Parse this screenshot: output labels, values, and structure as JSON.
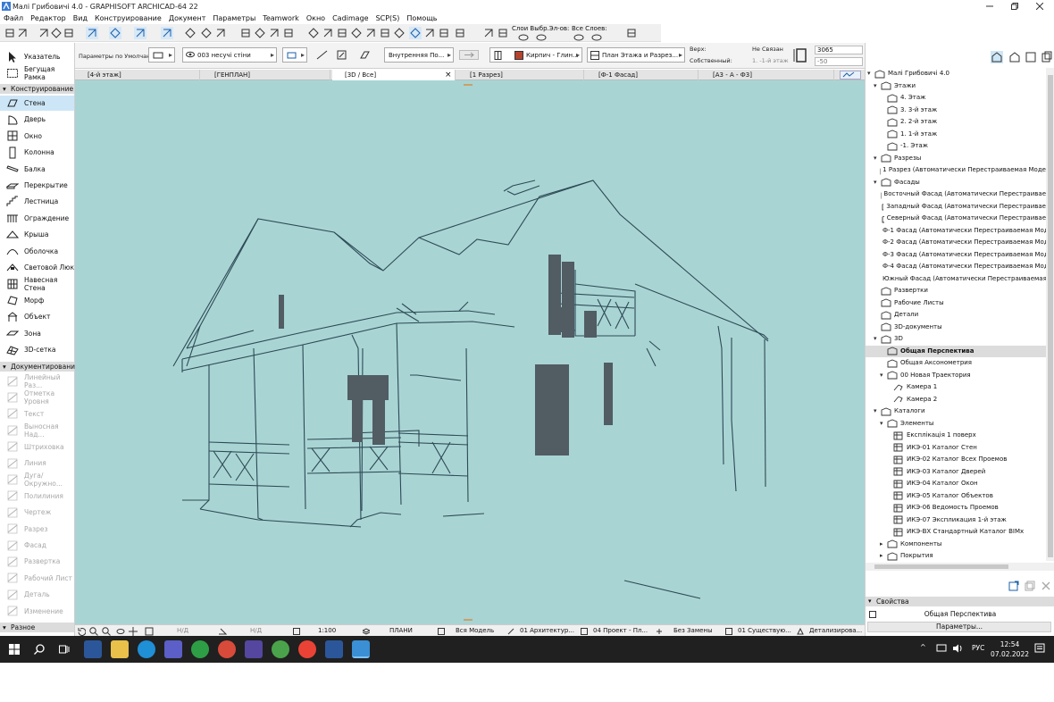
{
  "window": {
    "title": "Малі Грибовичі 4.0 - GRAPHISOFT ARCHICAD-64 22"
  },
  "menu": [
    "Файл",
    "Редактор",
    "Вид",
    "Конструирование",
    "Документ",
    "Параметры",
    "Teamwork",
    "Окно",
    "Cadimage",
    "SCP(S)",
    "Помощь"
  ],
  "toolbar": {
    "layers_label1": "Слои Выбр.Эл-ов:",
    "layers_label2": "Все Слоев:"
  },
  "infobox": {
    "params": "Параметры по Умолчанию",
    "layer": "003 несучі стіни",
    "structure": "Внутренняя По...",
    "material": "Кирпич - Глин...",
    "floors": "План Этажа и Разрез...",
    "top_label": "Верх:",
    "own_label": "Собственный:",
    "not_linked": "Не Связан",
    "floor_ref": "1. -1-й этаж",
    "height": "3065",
    "offset": "-50"
  },
  "tabs": [
    {
      "label": "[4-й этаж]"
    },
    {
      "label": "[ГЕНПЛАН]"
    },
    {
      "label": "[3D / Все]",
      "close": "×"
    },
    {
      "label": "[1 Разрез]"
    },
    {
      "label": "[Ф-1 Фасад]"
    },
    {
      "label": "[А3 - А - Ф3]"
    }
  ],
  "toolbox": {
    "top": [
      {
        "label": "Указатель",
        "icon": "arrow-pointer-icon"
      },
      {
        "label": "Бегущая Рамка",
        "icon": "marquee-icon"
      }
    ],
    "sec_design": "Конструирование",
    "design": [
      {
        "label": "Стена",
        "icon": "wall-icon"
      },
      {
        "label": "Дверь",
        "icon": "door-icon"
      },
      {
        "label": "Окно",
        "icon": "window-icon"
      },
      {
        "label": "Колонна",
        "icon": "column-icon"
      },
      {
        "label": "Балка",
        "icon": "beam-icon"
      },
      {
        "label": "Перекрытие",
        "icon": "slab-icon"
      },
      {
        "label": "Лестница",
        "icon": "stair-icon"
      },
      {
        "label": "Ограждение",
        "icon": "railing-icon"
      },
      {
        "label": "Крыша",
        "icon": "roof-icon"
      },
      {
        "label": "Оболочка",
        "icon": "shell-icon"
      },
      {
        "label": "Световой Люк",
        "icon": "skylight-icon"
      },
      {
        "label": "Навесная Стена",
        "icon": "curtain-wall-icon"
      },
      {
        "label": "Морф",
        "icon": "morph-icon"
      },
      {
        "label": "Объект",
        "icon": "object-icon"
      },
      {
        "label": "Зона",
        "icon": "zone-icon"
      },
      {
        "label": "3D-сетка",
        "icon": "mesh-icon"
      }
    ],
    "sec_doc": "Документирование",
    "doc": [
      {
        "label": "Линейный Раз...",
        "icon": "dimension-icon"
      },
      {
        "label": "Отметка Уровня",
        "icon": "level-icon"
      },
      {
        "label": "Текст",
        "icon": "text-icon"
      },
      {
        "label": "Выносная Над...",
        "icon": "label-icon"
      },
      {
        "label": "Штриховка",
        "icon": "fill-icon"
      },
      {
        "label": "Линия",
        "icon": "line-icon"
      },
      {
        "label": "Дуга/Окружно...",
        "icon": "arc-icon"
      },
      {
        "label": "Полилиния",
        "icon": "polyline-icon"
      },
      {
        "label": "Чертеж",
        "icon": "drawing-icon"
      },
      {
        "label": "Разрез",
        "icon": "section-icon"
      },
      {
        "label": "Фасад",
        "icon": "elevation-icon"
      },
      {
        "label": "Развертка",
        "icon": "interior-elevation-icon"
      },
      {
        "label": "Рабочий Лист",
        "icon": "worksheet-icon"
      },
      {
        "label": "Деталь",
        "icon": "detail-icon"
      },
      {
        "label": "Изменение",
        "icon": "change-icon"
      }
    ],
    "sec_misc": "Разное"
  },
  "navigator": {
    "tree": [
      {
        "d": 0,
        "t": "▾",
        "label": "Малі Грибовичі 4.0",
        "icon": "house-icon"
      },
      {
        "d": 1,
        "t": "▾",
        "label": "Этажи",
        "icon": "stories-icon"
      },
      {
        "d": 2,
        "t": "",
        "label": "4. Этаж",
        "icon": "story-icon"
      },
      {
        "d": 2,
        "t": "",
        "label": "3. 3-й этаж",
        "icon": "story-icon"
      },
      {
        "d": 2,
        "t": "",
        "label": "2. 2-й этаж",
        "icon": "story-icon"
      },
      {
        "d": 2,
        "t": "",
        "label": "1. 1-й этаж",
        "icon": "story-icon"
      },
      {
        "d": 2,
        "t": "",
        "label": "-1. Этаж",
        "icon": "story-icon"
      },
      {
        "d": 1,
        "t": "▾",
        "label": "Разрезы",
        "icon": "sections-icon"
      },
      {
        "d": 2,
        "t": "",
        "label": "1 Разрез (Автоматически Перестраиваемая Моде",
        "icon": "section-view-icon"
      },
      {
        "d": 1,
        "t": "▾",
        "label": "Фасады",
        "icon": "elevations-icon"
      },
      {
        "d": 2,
        "t": "",
        "label": "Восточный Фасад (Автоматически Перестраивае",
        "icon": "elevation-view-icon"
      },
      {
        "d": 2,
        "t": "",
        "label": "Западный Фасад (Автоматически Перестраивае",
        "icon": "elevation-view-icon"
      },
      {
        "d": 2,
        "t": "",
        "label": "Северный Фасад (Автоматически Перестраивае",
        "icon": "elevation-view-icon"
      },
      {
        "d": 2,
        "t": "",
        "label": "Ф-1 Фасад (Автоматически Перестраиваемая Моде",
        "icon": "elevation-view-icon"
      },
      {
        "d": 2,
        "t": "",
        "label": "Ф-2 Фасад (Автоматически Перестраиваемая Моде",
        "icon": "elevation-view-icon"
      },
      {
        "d": 2,
        "t": "",
        "label": "Ф-3 Фасад (Автоматически Перестраиваемая Моде",
        "icon": "elevation-view-icon"
      },
      {
        "d": 2,
        "t": "",
        "label": "Ф-4 Фасад (Автоматически Перестраиваемая Моде",
        "icon": "elevation-view-icon"
      },
      {
        "d": 2,
        "t": "",
        "label": "Южный Фасад (Автоматически Перестраиваемая",
        "icon": "elevation-view-icon"
      },
      {
        "d": 1,
        "t": "",
        "label": "Развертки",
        "icon": "interior-elevations-icon"
      },
      {
        "d": 1,
        "t": "",
        "label": "Рабочие Листы",
        "icon": "worksheets-icon"
      },
      {
        "d": 1,
        "t": "",
        "label": "Детали",
        "icon": "details-icon"
      },
      {
        "d": 1,
        "t": "",
        "label": "3D-документы",
        "icon": "3d-documents-icon"
      },
      {
        "d": 1,
        "t": "▾",
        "label": "3D",
        "icon": "3d-icon"
      },
      {
        "d": 2,
        "t": "",
        "label": "Общая Перспектива",
        "icon": "perspective-icon",
        "sel": true
      },
      {
        "d": 2,
        "t": "",
        "label": "Общая Аксонометрия",
        "icon": "axonometry-icon"
      },
      {
        "d": 2,
        "t": "▾",
        "label": "00 Новая Траектория",
        "icon": "path-icon"
      },
      {
        "d": 3,
        "t": "",
        "label": "Камера 1",
        "icon": "camera-icon"
      },
      {
        "d": 3,
        "t": "",
        "label": "Камера 2",
        "icon": "camera-icon"
      },
      {
        "d": 1,
        "t": "▾",
        "label": "Каталоги",
        "icon": "schedules-icon"
      },
      {
        "d": 2,
        "t": "▾",
        "label": "Элементы",
        "icon": "elements-icon"
      },
      {
        "d": 3,
        "t": "",
        "label": "Експлікація 1 поверх",
        "icon": "schedule-icon"
      },
      {
        "d": 3,
        "t": "",
        "label": "ИКЭ-01 Каталог Стен",
        "icon": "schedule-icon"
      },
      {
        "d": 3,
        "t": "",
        "label": "ИКЭ-02 Каталог Всех Проемов",
        "icon": "schedule-icon"
      },
      {
        "d": 3,
        "t": "",
        "label": "ИКЭ-03 Каталог Дверей",
        "icon": "schedule-icon"
      },
      {
        "d": 3,
        "t": "",
        "label": "ИКЭ-04 Каталог Окон",
        "icon": "schedule-icon"
      },
      {
        "d": 3,
        "t": "",
        "label": "ИКЭ-05 Каталог Объектов",
        "icon": "schedule-icon"
      },
      {
        "d": 3,
        "t": "",
        "label": "ИКЭ-06 Ведомость Проемов",
        "icon": "schedule-icon"
      },
      {
        "d": 3,
        "t": "",
        "label": "ИКЭ-07 Экспликация 1-й этаж",
        "icon": "schedule-icon"
      },
      {
        "d": 3,
        "t": "",
        "label": "ИКЭ-ВХ Стандартный Каталог BIMx",
        "icon": "schedule-icon"
      },
      {
        "d": 2,
        "t": "▸",
        "label": "Компоненты",
        "icon": "components-icon"
      },
      {
        "d": 2,
        "t": "▸",
        "label": "Покрытия",
        "icon": "surfaces-icon"
      }
    ],
    "props_header": "Свойства",
    "props_name": "Общая Перспектива",
    "params_button": "Параметры..."
  },
  "status": {
    "na1": "Н/Д",
    "na2": "Н/Д",
    "scale": "1:100",
    "plans": "ПЛАНИ",
    "model": "Вся Модель",
    "arch": "01 Архитектур...",
    "proj": "04 Проект - Пл...",
    "noreplace": "Без Замены",
    "exist": "01 Существую...",
    "detail": "Детализирова..."
  },
  "taskbar": {
    "lang": "РУС",
    "time": "12:54",
    "date": "07.02.2022"
  },
  "colors": {
    "view_bg": "#a9d4d4",
    "line": "#2d4a55",
    "dark": "#515c63",
    "accent": "#0078d4"
  }
}
